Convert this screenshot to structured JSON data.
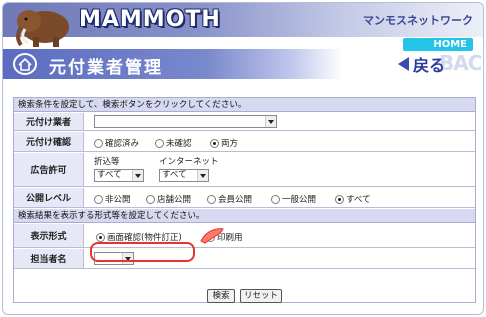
{
  "header": {
    "brand": "MAMMOTH",
    "network": "マンモスネットワーク",
    "home": "HOME",
    "title": "元付業者管理",
    "back": "戻る",
    "back_ghost": "BACK"
  },
  "search": {
    "section_title": "検索条件を設定して、検索ボタンをクリックしてください。",
    "motozuke_label": "元付け業者",
    "motozuke_value": "",
    "confirm_label": "元付け確認",
    "confirm_options": [
      "確認済み",
      "未確認",
      "両方"
    ],
    "confirm_selected": "両方",
    "ad_label": "広告許可",
    "ad_sub1": "折込等",
    "ad_sub1_value": "すべて",
    "ad_sub2": "インターネット",
    "ad_sub2_value": "すべて",
    "public_label": "公開レベル",
    "public_options": [
      "非公開",
      "店舗公開",
      "会員公開",
      "一般公開",
      "すべて"
    ],
    "public_selected": "すべて"
  },
  "display": {
    "section_title": "検索結果を表示する形式等を設定してください。",
    "format_label": "表示形式",
    "format_options": [
      "画面確認(物件訂正)",
      "印刷用"
    ],
    "format_selected": "画面確認(物件訂正)",
    "staff_label": "担当者名",
    "staff_value": ""
  },
  "buttons": {
    "search": "検索",
    "reset": "リセット"
  },
  "colors": {
    "accent": "#5b6cc1",
    "home": "#24c4e6",
    "highlight": "#e8332b"
  }
}
